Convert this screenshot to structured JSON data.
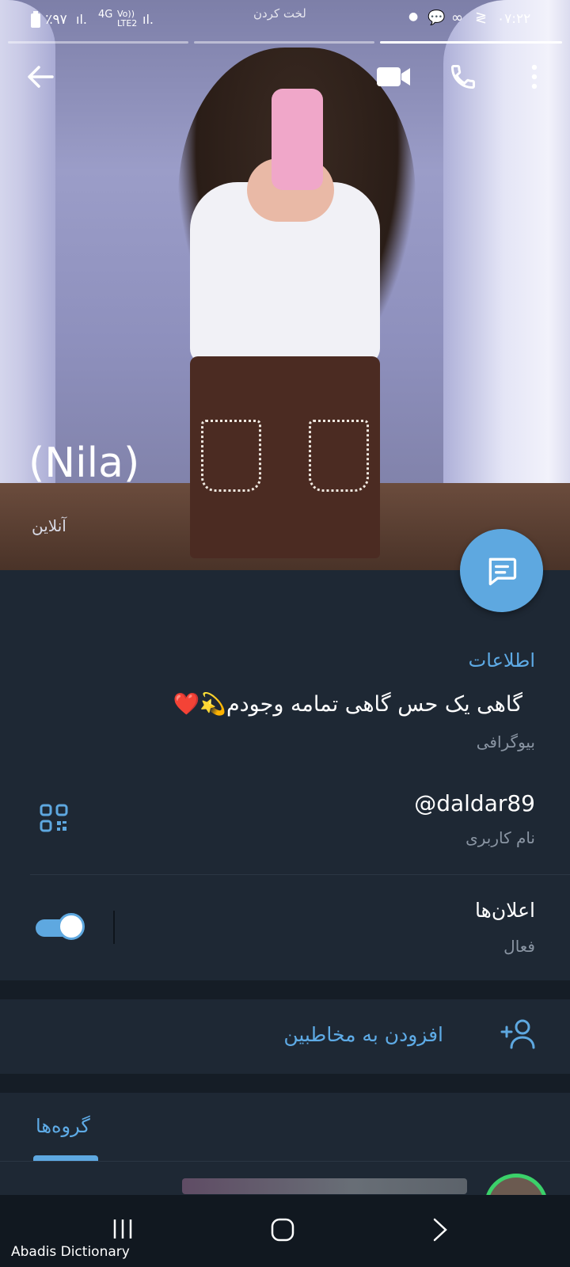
{
  "status_bar": {
    "battery": "٪۹۷",
    "network": "4G",
    "volte": "Vo)) LTE2",
    "center_text": "لخت کردن",
    "time": "۰۷:۲۲"
  },
  "profile": {
    "name": "(Nila)",
    "status": "آنلاین"
  },
  "toolbar": {
    "back_icon": "arrow-left-icon",
    "video_icon": "video-camera-icon",
    "call_icon": "phone-icon",
    "menu_icon": "more-vertical-icon"
  },
  "info": {
    "section_title": "اطلاعات",
    "bio": "گاهی یک حس گاهی تمامه وجودم💫❤️",
    "bio_label": "بیوگرافی",
    "username": "@daldar89",
    "username_label": "نام کاربری",
    "notifications_title": "اعلان‌ها",
    "notifications_status": "فعال"
  },
  "actions": {
    "add_contact": "افزودن به مخاطبین"
  },
  "tabs": {
    "groups": "گروه‌ها"
  },
  "nav": {
    "app_label": "Abadis Dictionary"
  },
  "colors": {
    "accent": "#5ea8e0",
    "panel": "#1e2834",
    "divider_band": "#151d26"
  }
}
